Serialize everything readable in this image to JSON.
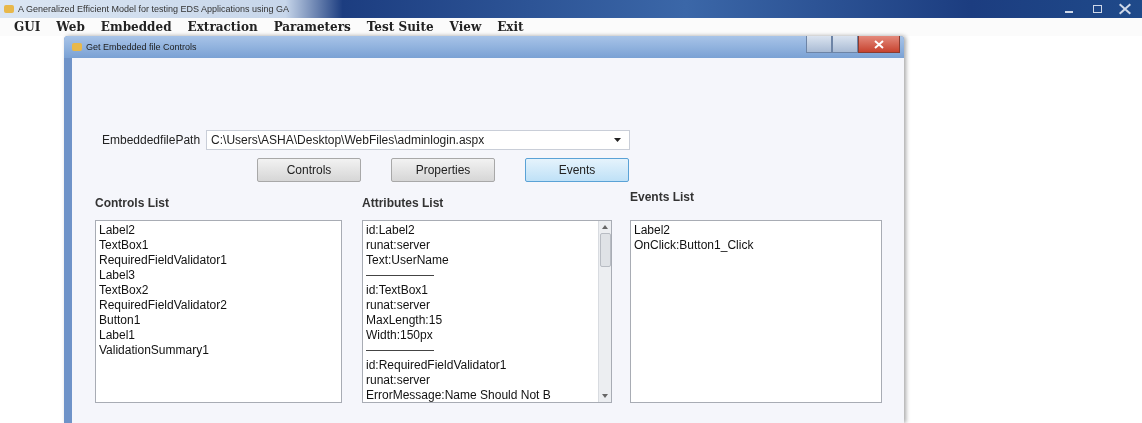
{
  "window": {
    "title": "A Generalized Efficient Model for testing EDS Applications using GA"
  },
  "menu": [
    "GUI",
    "Web",
    "Embedded",
    "Extraction",
    "Parameters",
    "Test Suite",
    "View",
    "Exit"
  ],
  "dialog": {
    "title": "Get Embedded file Controls",
    "path_label": "EmbeddedfilePath",
    "path_value": "C:\\Users\\ASHA\\Desktop\\WebFiles\\adminlogin.aspx",
    "buttons": [
      {
        "label": "Controls",
        "selected": false
      },
      {
        "label": "Properties",
        "selected": false
      },
      {
        "label": "Events",
        "selected": true
      }
    ],
    "controls_list": {
      "heading": "Controls List",
      "items": [
        "Label2",
        "TextBox1",
        "RequiredFieldValidator1",
        "Label3",
        "TextBox2",
        "RequiredFieldValidator2",
        "Button1",
        "Label1",
        "ValidationSummary1"
      ]
    },
    "attributes_list": {
      "heading": "Attributes List",
      "items": [
        {
          "kind": "text",
          "text": "id:Label2"
        },
        {
          "kind": "text",
          "text": "runat:server"
        },
        {
          "kind": "text",
          "text": "Text:UserName"
        },
        {
          "kind": "separator"
        },
        {
          "kind": "text",
          "text": "id:TextBox1"
        },
        {
          "kind": "text",
          "text": "runat:server"
        },
        {
          "kind": "text",
          "text": "MaxLength:15"
        },
        {
          "kind": "text",
          "text": "Width:150px"
        },
        {
          "kind": "separator"
        },
        {
          "kind": "text",
          "text": "id:RequiredFieldValidator1"
        },
        {
          "kind": "text",
          "text": "runat:server"
        },
        {
          "kind": "text",
          "text": "ErrorMessage:Name Should Not B"
        }
      ]
    },
    "events_list": {
      "heading": "Events List",
      "items": [
        "Label2",
        "OnClick:Button1_Click"
      ]
    }
  }
}
